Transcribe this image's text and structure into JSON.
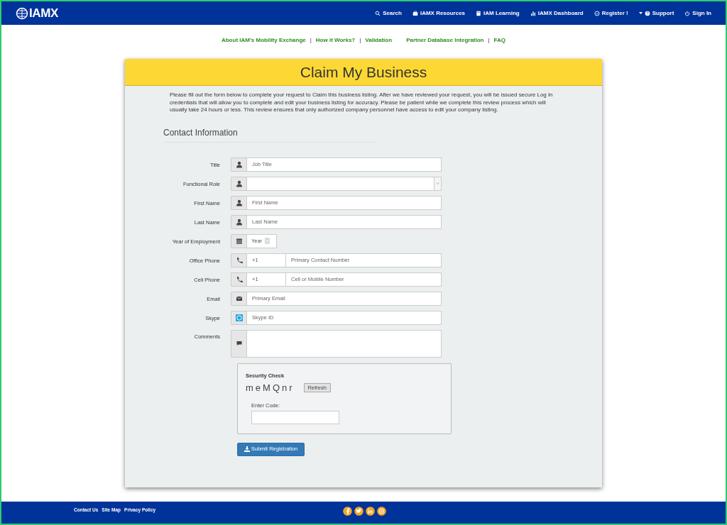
{
  "header": {
    "logo": "IAMX",
    "nav": [
      {
        "kind": "search",
        "label": "Search"
      },
      {
        "kind": "briefcase",
        "label": "IAMX Resources"
      },
      {
        "kind": "book",
        "label": "IAM Learning"
      },
      {
        "kind": "bars",
        "label": "IAMX Dashboard"
      },
      {
        "kind": "check",
        "label": "Register !"
      },
      {
        "kind": "help",
        "label": "Support"
      },
      {
        "kind": "power",
        "label": "Sign In"
      }
    ]
  },
  "subnav": [
    {
      "kind": "link",
      "label": "About IAM's Mobility Exchange"
    },
    {
      "kind": "separator",
      "label": "|"
    },
    {
      "kind": "link",
      "label": "How it Works?"
    },
    {
      "kind": "separator",
      "label": "|"
    },
    {
      "kind": "link",
      "label": "Validation"
    },
    {
      "kind": "link",
      "label": "Partner Database Integration"
    },
    {
      "kind": "separator",
      "label": "|"
    },
    {
      "kind": "link",
      "label": "FAQ"
    }
  ],
  "card": {
    "title": "Claim My Business",
    "intro": "Please fill out the form below to complete your request to Claim this business listing. After we have reviewed your request, you will be issued secure Log In credentials that will allow you to complete and edit your business listing for accuracy. Please be patient while we complete this review process which will usually take 24 hours or less. This review ensures that only authorized company personnel have access to edit your company listing.",
    "section": "Contact Information",
    "fields": [
      {
        "kind": "text",
        "label": "Title",
        "placeholder": "Job Title"
      },
      {
        "kind": "select",
        "label": "Functional Role"
      },
      {
        "kind": "text",
        "label": "First Name",
        "placeholder": "First Name"
      },
      {
        "kind": "text",
        "label": "Last Name",
        "placeholder": "Last Name"
      },
      {
        "kind": "year",
        "label": "Year of Employment",
        "placeholder": "Year"
      },
      {
        "kind": "phone",
        "label": "Office Phone",
        "code": "+1",
        "placeholder": "Primary Contact Number"
      },
      {
        "kind": "phone",
        "label": "Cell Phone",
        "code": "+1",
        "placeholder": "Cell or Mobile Number"
      },
      {
        "kind": "email",
        "label": "Email",
        "placeholder": "Primary Email"
      },
      {
        "kind": "skype",
        "label": "Skype",
        "placeholder": "Skype ID"
      },
      {
        "kind": "textarea",
        "label": "Comments"
      }
    ],
    "security": {
      "title": "Security Check",
      "captcha": "meMQnr",
      "refresh": "Refresh",
      "code_label": "Enter Code:"
    },
    "submit": "Submit Registration"
  },
  "footer": {
    "links": [
      "Contact Us",
      "Site Map",
      "Privacy Policy"
    ],
    "social": [
      {
        "kind": "facebook"
      },
      {
        "kind": "twitter"
      },
      {
        "kind": "linkedin"
      },
      {
        "kind": "instagram"
      }
    ]
  }
}
